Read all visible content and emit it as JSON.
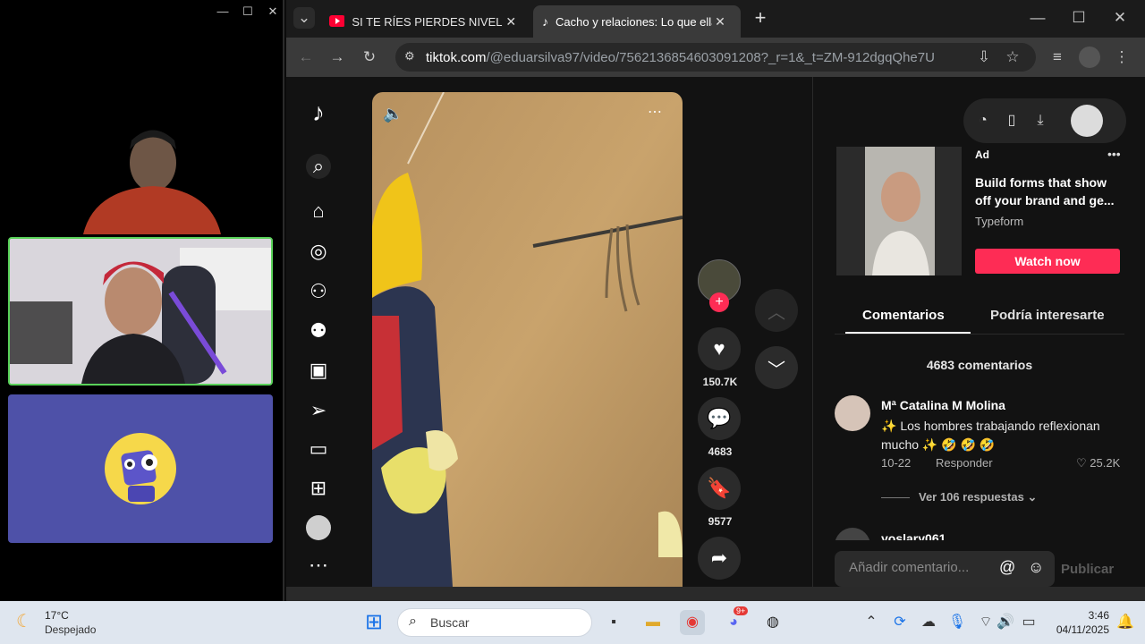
{
  "call_window": {
    "controls": {
      "minimize": "—",
      "maximize": "☐",
      "close": "✕"
    }
  },
  "browser": {
    "tabs": [
      {
        "title": "SI TE RÍES PIERDES NIVEL DIOS (",
        "icon": "youtube-icon"
      },
      {
        "title": "Cacho y relaciones: Lo que ellas",
        "icon": "tiktok-icon",
        "active": true
      }
    ],
    "new_tab_label": "+",
    "url": {
      "host": "tiktok.com",
      "path": "/@eduarsilva97/video/7562136854603091208?_r=1&_t=ZM-912dgqQhe7U"
    }
  },
  "video": {
    "sound_icon": "speaker-icon",
    "likes": "150.7K",
    "comments": "4683",
    "saves": "9577"
  },
  "ad": {
    "label": "Ad",
    "headline": "Build forms that show off your brand and ge...",
    "brand": "Typeform",
    "cta": "Watch now",
    "more": "•••"
  },
  "comments_panel": {
    "tabs": [
      "Comentarios",
      "Podría interesarte"
    ],
    "count_text": "4683 comentarios",
    "comment": {
      "user": "Mª Catalina M Molina",
      "text": "✨ Los hombres trabajando reflexionan mucho ✨ 🤣 🤣 🤣",
      "date": "10-22",
      "reply_label": "Responder",
      "likes": "25.2K"
    },
    "view_replies": "Ver 106 respuestas",
    "partial_user": "yoslary061",
    "composer_placeholder": "Añadir comentario...",
    "publish_label": "Publicar"
  },
  "taskbar": {
    "weather": {
      "temp": "17°C",
      "condition": "Despejado"
    },
    "search_placeholder": "Buscar",
    "time": "3:46",
    "date": "04/11/2025",
    "discord_badge": "9+"
  },
  "colors": {
    "tiktok_pink": "#fe2c55",
    "active_speaker_border": "#5ad25a",
    "avatar_tile_bg": "#4e51a8"
  }
}
